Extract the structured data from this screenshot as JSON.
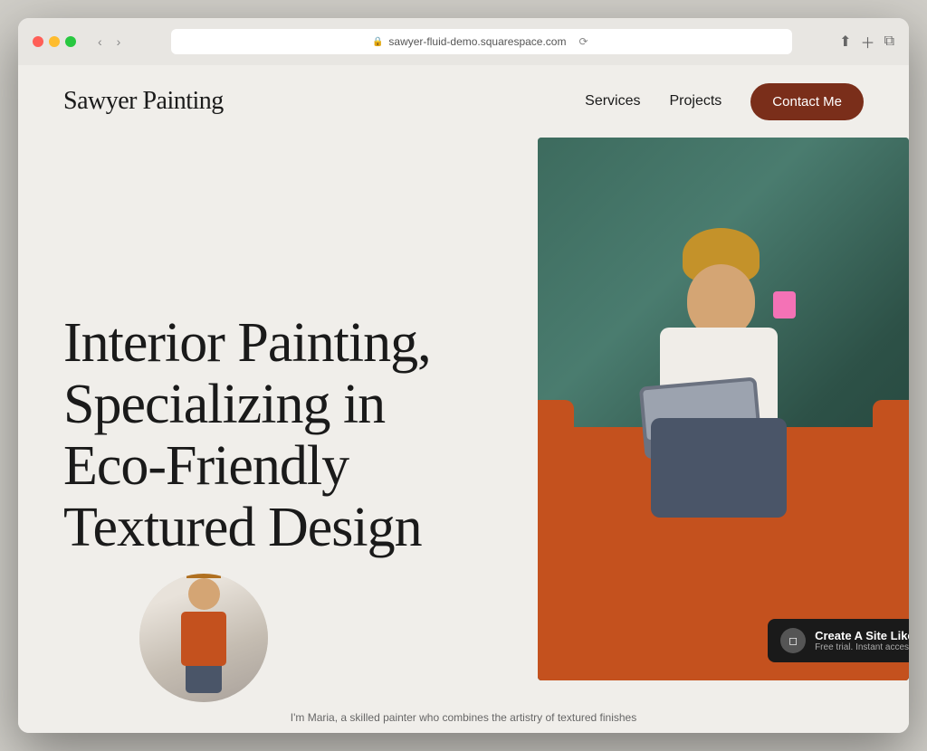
{
  "browser": {
    "url": "sawyer-fluid-demo.squarespace.com",
    "reload_label": "⟳"
  },
  "nav": {
    "logo": "Sawyer Painting",
    "links": [
      {
        "label": "Services",
        "id": "services"
      },
      {
        "label": "Projects",
        "id": "projects"
      }
    ],
    "cta": "Contact Me"
  },
  "hero": {
    "heading": "Interior Painting, Specializing in Eco-Friendly Textured Design",
    "caption": "I'm Maria, a skilled painter who combines the artistry of textured finishes"
  },
  "badge": {
    "main": "Create A Site Like This",
    "sub": "Free trial. Instant access.",
    "logo": "◻"
  }
}
